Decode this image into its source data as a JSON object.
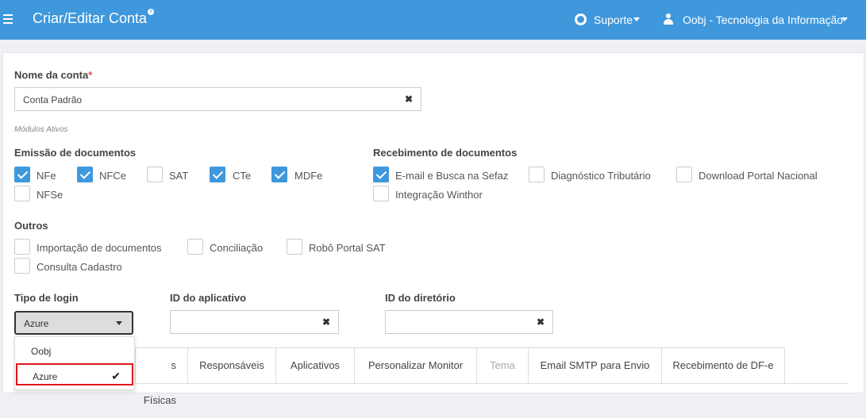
{
  "header": {
    "title": "Criar/Editar Conta",
    "info_icon": "i",
    "support_label": "Suporte",
    "user_label": "Oobj - Tecnologia da Informação",
    "brand_color": "#3f98dc"
  },
  "form": {
    "account_name_label": "Nome da conta",
    "required_mark": "*",
    "account_name_value": "Conta Padrão",
    "clear_symbol": "✖",
    "modules_caption": "Módulos Ativos"
  },
  "emission": {
    "title": "Emissão de documentos",
    "items": [
      {
        "label": "NFe",
        "checked": true
      },
      {
        "label": "NFCe",
        "checked": true
      },
      {
        "label": "SAT",
        "checked": false
      },
      {
        "label": "CTe",
        "checked": true
      },
      {
        "label": "MDFe",
        "checked": true
      },
      {
        "label": "NFSe",
        "checked": false
      }
    ]
  },
  "reception": {
    "title": "Recebimento de documentos",
    "items": [
      {
        "label": "E-mail e Busca na Sefaz",
        "checked": true
      },
      {
        "label": "Diagnóstico Tributário",
        "checked": false
      },
      {
        "label": "Download Portal Nacional",
        "checked": false
      },
      {
        "label": "Integração Winthor",
        "checked": false
      }
    ]
  },
  "others": {
    "title": "Outros",
    "items": [
      {
        "label": "Importação de documentos",
        "checked": false
      },
      {
        "label": "Conciliação",
        "checked": false
      },
      {
        "label": "Robô Portal SAT",
        "checked": false
      },
      {
        "label": "Consulta Cadastro",
        "checked": false
      }
    ]
  },
  "login": {
    "type_label": "Tipo de login",
    "selected": "Azure",
    "options": [
      "Oobj",
      "Azure"
    ],
    "app_id_label": "ID do aplicativo",
    "app_id_value": "",
    "dir_id_label": "ID do diretório",
    "dir_id_value": "",
    "checkmark": "✔"
  },
  "tabs": [
    {
      "label": "s Físicas",
      "disabled": false
    },
    {
      "label": "Responsáveis",
      "disabled": false
    },
    {
      "label": "Aplicativos",
      "disabled": false
    },
    {
      "label": "Personalizar Monitor",
      "disabled": false
    },
    {
      "label": "Tema",
      "disabled": true
    },
    {
      "label": "Email SMTP para Envio",
      "disabled": false
    },
    {
      "label": "Recebimento de DF-e",
      "disabled": false
    }
  ]
}
